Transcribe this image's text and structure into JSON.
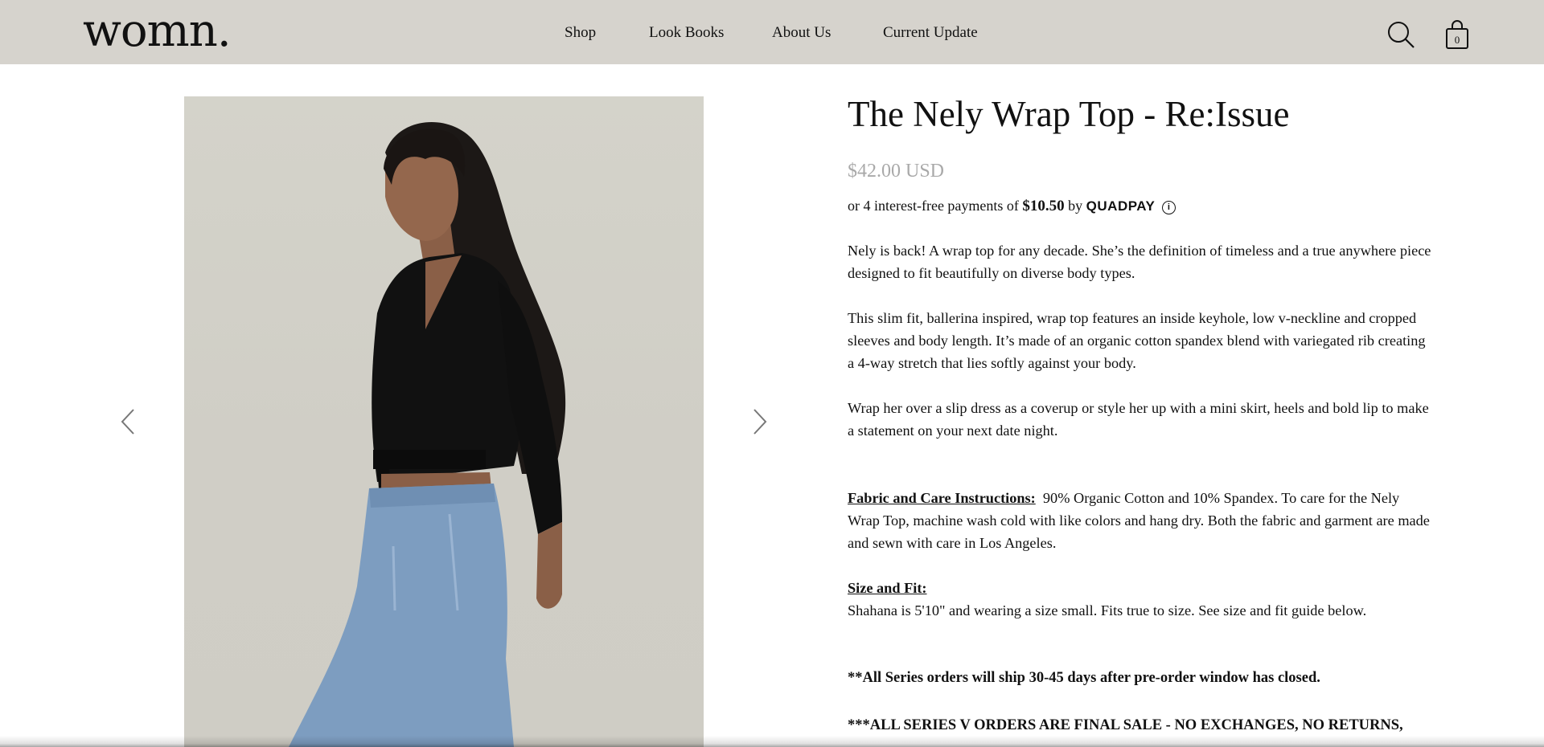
{
  "header": {
    "logo": "womn.",
    "nav": [
      "Shop",
      "Look Books",
      "About Us",
      "Current Update"
    ],
    "cart_count": "0"
  },
  "colors": {
    "header_bg": "#d6d3cd",
    "price": "#a9a9a9",
    "photo_bg": "#d2d0c8"
  },
  "icons": {
    "search": "search-icon",
    "cart": "shopping-bag-icon",
    "prev": "chevron-left-icon",
    "next": "chevron-right-icon",
    "info": "info-icon"
  },
  "product": {
    "title": "The Nely Wrap Top - Re:Issue",
    "price": "$42.00 USD",
    "quadpay": {
      "prefix": "or 4 interest-free payments of",
      "amount": "$10.50",
      "by": "by",
      "brand": "QUADPAY",
      "info": "i"
    },
    "description": [
      "Nely is back! A wrap top for any decade. She’s the definition of timeless and a true anywhere piece designed to fit beautifully on diverse body types.",
      "This slim fit, ballerina inspired, wrap top features an inside keyhole, low v-neckline and cropped sleeves and body length. It’s made of an organic cotton spandex blend with variegated rib creating a 4-way stretch that lies softly against your body.",
      "Wrap her over a slip dress as a coverup or style her up with a mini skirt, heels and bold lip to make a statement on your next date night."
    ],
    "fabric": {
      "heading": "Fabric and Care Instructions:",
      "text": "90% Organic Cotton and 10% Spandex. To care for the Nely Wrap Top, machine wash cold with like colors and hang dry. Both the fabric and garment are made and sewn with care in Los Angeles."
    },
    "size": {
      "heading": "Size and Fit:",
      "text": "Shahana is 5'10\" and wearing a size small. Fits true to size. See size and fit guide below."
    },
    "notices": [
      "**All Series orders will ship 30-45 days after pre-order window has closed.",
      "***ALL SERIES V ORDERS ARE FINAL SALE - NO EXCHANGES, NO RETURNS,"
    ]
  }
}
